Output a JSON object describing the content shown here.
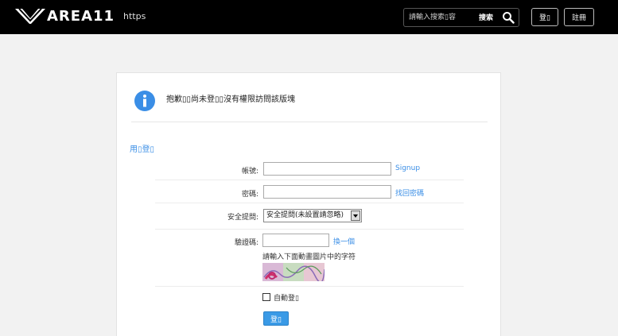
{
  "header": {
    "logo_text": "AREA11",
    "protocol": "https",
    "search_placeholder": "請輸入搜索▯容",
    "search_button": "搜索",
    "login_button": "登▯",
    "register_button": "註冊"
  },
  "notice": {
    "message": "抱歉▯▯尚未登▯▯沒有權限訪問該版塊"
  },
  "login_form": {
    "section_title": "用▯登▯",
    "username_label": "帳號:",
    "username_value": "",
    "signup_link": "Signup",
    "password_label": "密碼:",
    "password_value": "",
    "forgot_link": "找回密碼",
    "security_label": "安全提問:",
    "security_selected": "安全提問(未設置請忽略)",
    "captcha_label": "驗證碼:",
    "captcha_value": "",
    "captcha_refresh": "換一個",
    "captcha_hint": "請輸入下面動畫圖片中的字符",
    "auto_login_label": "自動登▯",
    "auto_login_checked": false,
    "submit_button": "登▯"
  },
  "colors": {
    "topbar": "#000000",
    "accent": "#3a8ee6",
    "button": "#3a9ae6",
    "background": "#f2f2f2"
  },
  "icons": {
    "logo": "area11-wings-logo",
    "search": "search-icon",
    "notice": "info-icon",
    "select": "chevron-down-icon"
  }
}
